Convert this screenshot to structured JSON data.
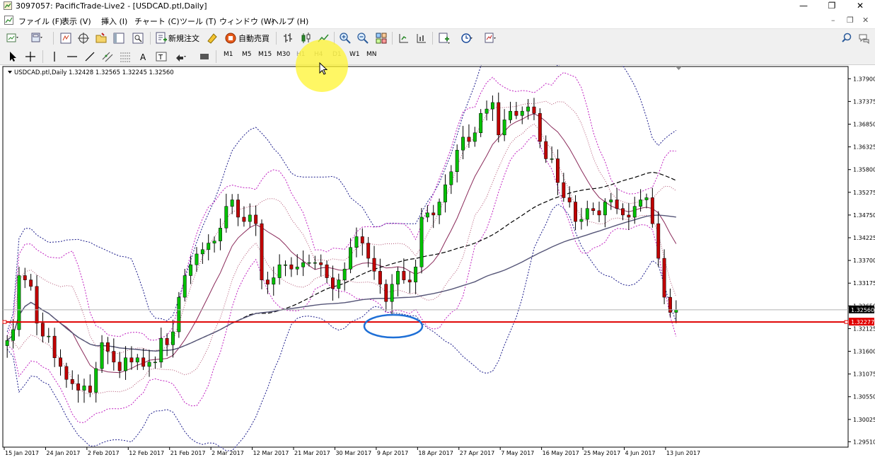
{
  "window": {
    "title": "3097057: PacificTrade-Live2 - [USDCAD.ptl,Daily]"
  },
  "menu": [
    "ファイル (F)",
    "表示 (V)",
    "挿入 (I)",
    "チャート (C)",
    "ツール (T)",
    "ウィンドウ (W)",
    "ヘルプ (H)"
  ],
  "toolbar": {
    "new_order": "新規注文",
    "auto_trading": "自動売買"
  },
  "timeframes": [
    "M1",
    "M5",
    "M15",
    "M30",
    "H1",
    "H4",
    "D1",
    "W1",
    "MN"
  ],
  "chart_info": {
    "symbol": "USDCAD.ptl,Daily",
    "ohlc": "1.32428 1.32565 1.32245 1.32560"
  },
  "colors": {
    "up": "#00c000",
    "down": "#c00000",
    "hline": "#e00000",
    "ellipse": "#1e6fd6",
    "price_marker": "#000000"
  },
  "chart_data": {
    "type": "candlestick",
    "symbol": "USDCAD.ptl",
    "timeframe": "Daily",
    "price_scale": [
      "1.37900",
      "1.37375",
      "1.36850",
      "1.36325",
      "1.35800",
      "1.35275",
      "1.34750",
      "1.34225",
      "1.33700",
      "1.33175",
      "1.32650",
      "1.32125",
      "1.31600",
      "1.31075",
      "1.30550",
      "1.30025",
      "1.29510"
    ],
    "x_labels": [
      "15 Jan 2017",
      "24 Jan 2017",
      "2 Feb 2017",
      "12 Feb 2017",
      "21 Feb 2017",
      "2 Mar 2017",
      "12 Mar 2017",
      "21 Mar 2017",
      "30 Mar 2017",
      "9 Apr 2017",
      "18 Apr 2017",
      "27 Apr 2017",
      "7 May 2017",
      "16 May 2017",
      "25 May 2017",
      "4 Jun 2017",
      "13 Jun 2017"
    ],
    "ylim": [
      1.2945,
      1.3815
    ],
    "current_price": "1.32560",
    "current_price_value": 1.3256,
    "horizontal_line": "1.32277",
    "horizontal_line_value": 1.32277,
    "closes": [
      1.3185,
      1.321,
      1.3335,
      1.3325,
      1.331,
      1.3225,
      1.3195,
      1.3195,
      1.3145,
      1.3125,
      1.3095,
      1.3085,
      1.307,
      1.308,
      1.3065,
      1.312,
      1.318,
      1.316,
      1.3135,
      1.3115,
      1.3145,
      1.3135,
      1.3145,
      1.3125,
      1.3135,
      1.3135,
      1.319,
      1.3175,
      1.3205,
      1.3285,
      1.3335,
      1.336,
      1.3385,
      1.3395,
      1.341,
      1.3415,
      1.3445,
      1.3495,
      1.351,
      1.347,
      1.346,
      1.3475,
      1.3455,
      1.3325,
      1.3315,
      1.333,
      1.336,
      1.336,
      1.335,
      1.3355,
      1.3365,
      1.3365,
      1.3365,
      1.336,
      1.333,
      1.3305,
      1.3325,
      1.335,
      1.34,
      1.3425,
      1.341,
      1.3375,
      1.3345,
      1.3315,
      1.3275,
      1.3315,
      1.3345,
      1.3325,
      1.332,
      1.3355,
      1.347,
      1.348,
      1.3475,
      1.3505,
      1.3545,
      1.3575,
      1.3625,
      1.3655,
      1.3645,
      1.3665,
      1.371,
      1.372,
      1.3735,
      1.366,
      1.3695,
      1.3715,
      1.3705,
      1.3715,
      1.3725,
      1.371,
      1.3645,
      1.3605,
      1.3605,
      1.355,
      1.3515,
      1.3505,
      1.346,
      1.3465,
      1.349,
      1.3485,
      1.3475,
      1.3505,
      1.351,
      1.349,
      1.3475,
      1.347,
      1.3495,
      1.351,
      1.3515,
      1.3455,
      1.3375,
      1.3285,
      1.325,
      1.3256
    ]
  }
}
